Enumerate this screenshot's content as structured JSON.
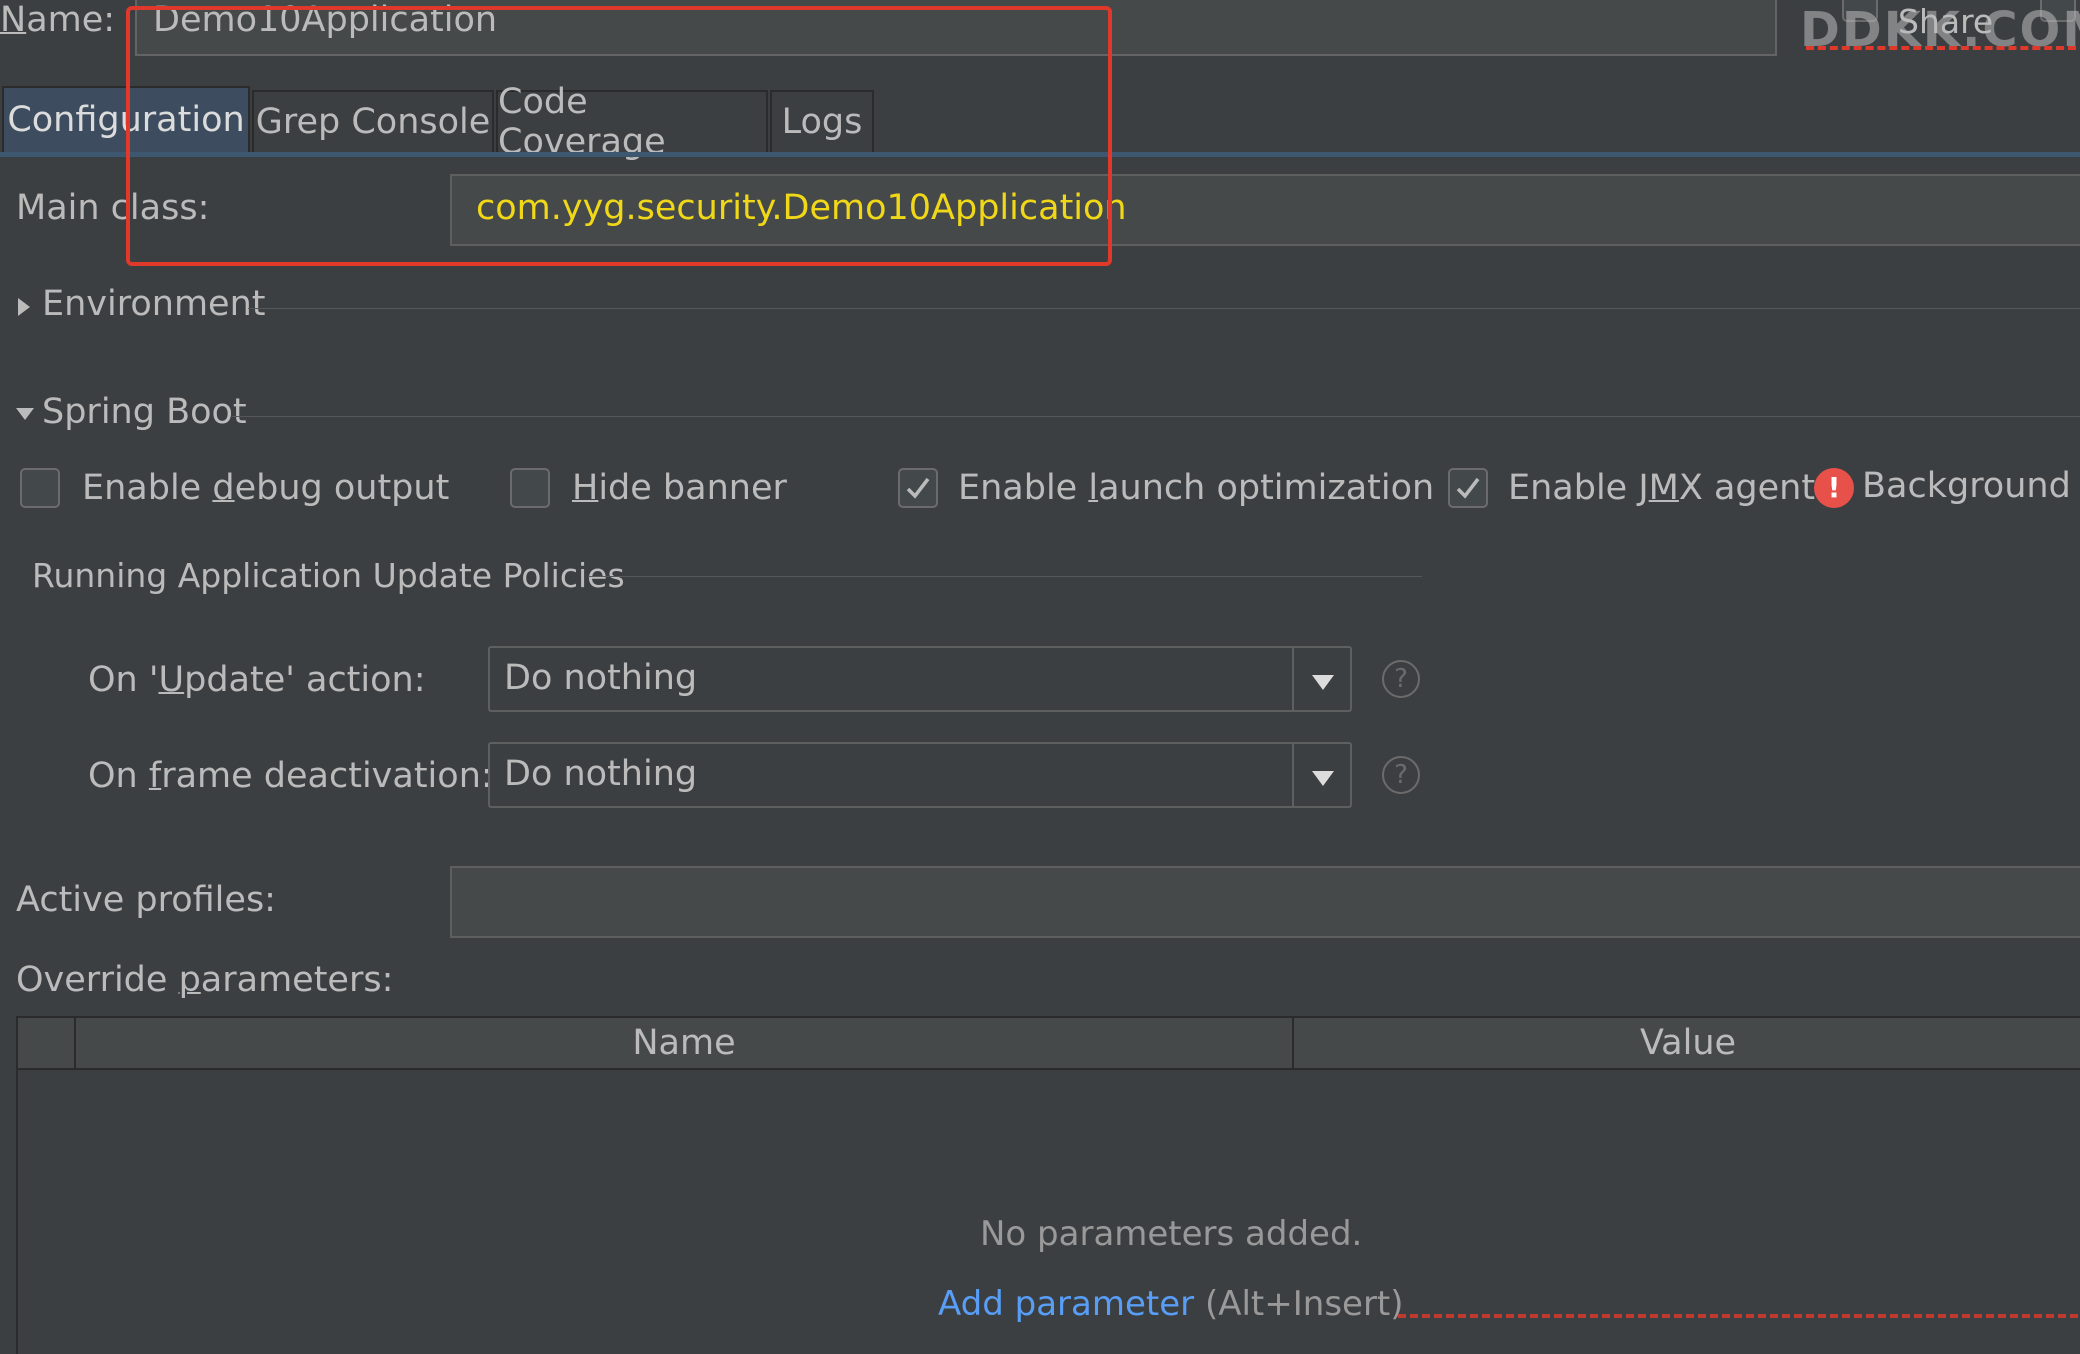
{
  "name_field": {
    "label_prefix": "",
    "label_mnemonic": "N",
    "label_rest": "ame:",
    "value": "Demo10Application"
  },
  "share": {
    "label": "Share"
  },
  "watermark": "DDKK.COM",
  "tabs": [
    {
      "label": "Configuration"
    },
    {
      "label": "Grep Console"
    },
    {
      "label": "Code Coverage"
    },
    {
      "label": "Logs"
    }
  ],
  "main_class": {
    "label": "Main class:",
    "value": "com.yyg.security.Demo10Application"
  },
  "environment": {
    "label": "Environment"
  },
  "spring_boot": {
    "label": "Spring Boot",
    "checkboxes": [
      {
        "pre": "Enable ",
        "mn": "d",
        "post": "ebug output",
        "checked": false
      },
      {
        "pre": "",
        "mn": "H",
        "post": "ide banner",
        "checked": false
      },
      {
        "pre": "Enable ",
        "mn": "l",
        "post": "aunch optimization",
        "checked": true
      },
      {
        "pre": "Enable J",
        "mn": "M",
        "post": "X agent",
        "checked": true
      }
    ],
    "background_label": "Background c"
  },
  "update_policies": {
    "title": "Running Application Update Policies",
    "update_action": {
      "pre": "On '",
      "mn": "U",
      "post": "pdate' action:",
      "value": "Do nothing"
    },
    "frame_deactivation": {
      "pre": "On ",
      "mn": "f",
      "post": "rame deactivation:",
      "value": "Do nothing"
    }
  },
  "active_profiles": {
    "label": "Active profiles:",
    "value": ""
  },
  "override_parameters": {
    "pre": "Override ",
    "mn": "p",
    "post": "arameters:",
    "columns": [
      "Name",
      "Value"
    ],
    "empty_text": "No parameters added.",
    "add_link": "Add parameter",
    "add_shortcut": "(Alt+Insert)"
  },
  "colors": {
    "accent": "#589df6",
    "highlight_box": "#e0392b",
    "main_class_text": "#f0d818",
    "error": "#e8504a"
  }
}
